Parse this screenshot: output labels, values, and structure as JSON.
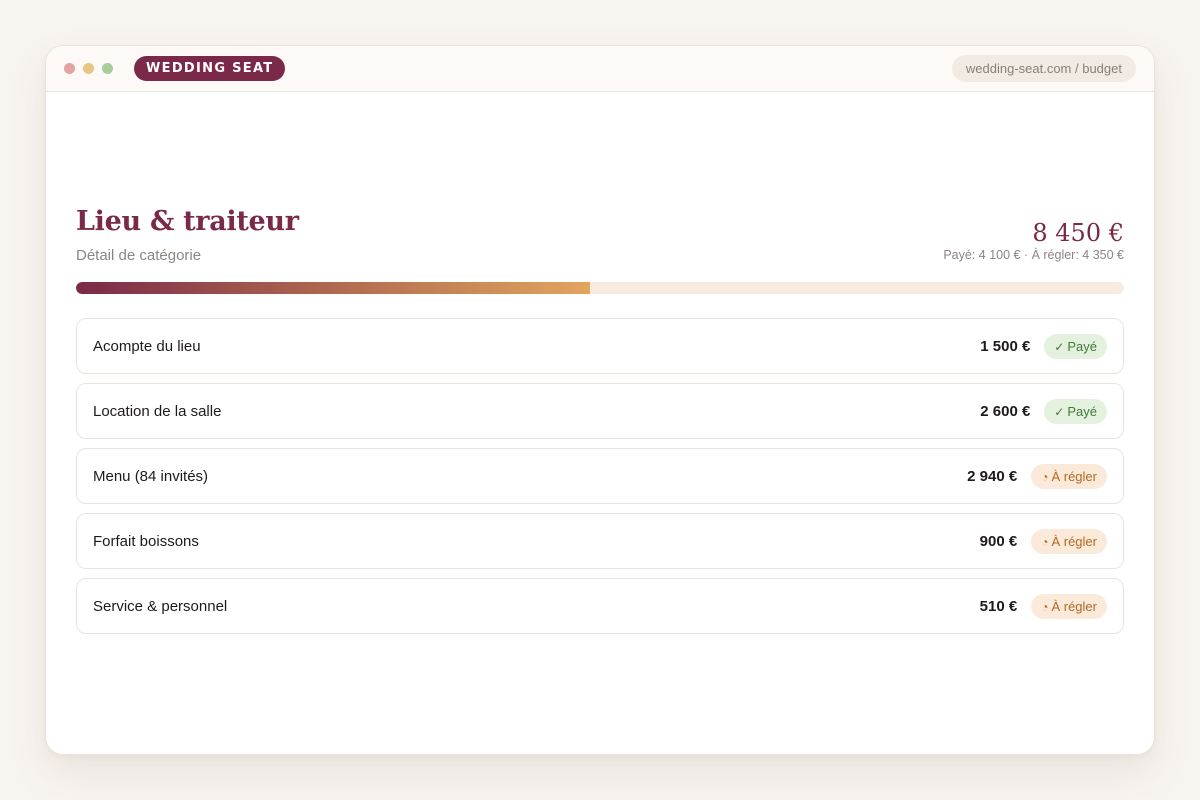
{
  "window": {
    "brand": "WEDDING SEAT",
    "url": "wedding-seat.com / budget"
  },
  "category": {
    "title": "Lieu & traiteur",
    "subtitle": "Détail de catégorie",
    "total": "8 450 €",
    "breakdown": "Payé: 4 100 € · À régler: 4 350 €",
    "paid_fraction": 0.49
  },
  "items": [
    {
      "label": "Acompte du lieu",
      "amount": "1 500 €",
      "status": "paid",
      "status_label": "Payé",
      "status_icon": "✓"
    },
    {
      "label": "Location de la salle",
      "amount": "2 600 €",
      "status": "paid",
      "status_label": "Payé",
      "status_icon": "✓"
    },
    {
      "label": "Menu (84 invités)",
      "amount": "2 940 €",
      "status": "due",
      "status_label": "À régler",
      "status_icon": "◔"
    },
    {
      "label": "Forfait boissons",
      "amount": "900 €",
      "status": "due",
      "status_label": "À régler",
      "status_icon": "◔"
    },
    {
      "label": "Service & personnel",
      "amount": "510 €",
      "status": "due",
      "status_label": "À régler",
      "status_icon": "◔"
    }
  ],
  "colors": {
    "brand": "#7a2a48",
    "paid_badge_bg": "#e4f1df",
    "paid_badge_text": "#3f7a3a",
    "due_badge_bg": "#fbead9",
    "due_badge_text": "#b06a22"
  }
}
